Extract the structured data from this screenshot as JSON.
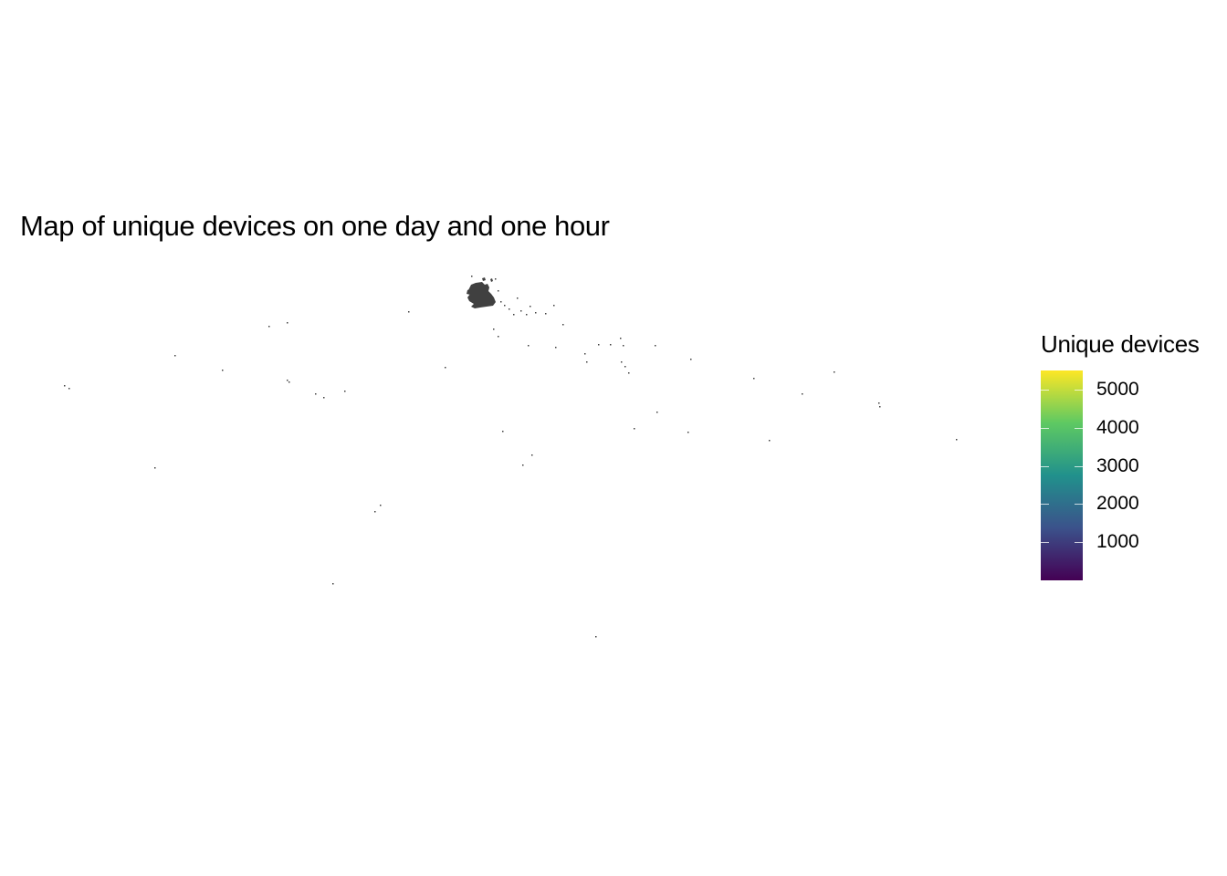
{
  "title": "Map of unique devices on one day and one hour",
  "legend": {
    "title": "Unique devices",
    "min": 0,
    "max": 5500,
    "ticks": [
      {
        "value": 5000,
        "label": "5000"
      },
      {
        "value": 4000,
        "label": "4000"
      },
      {
        "value": 3000,
        "label": "3000"
      },
      {
        "value": 2000,
        "label": "2000"
      },
      {
        "value": 1000,
        "label": "1000"
      }
    ],
    "colors": [
      "#440154",
      "#3b528b",
      "#21918c",
      "#5ec962",
      "#fde725"
    ]
  },
  "map": {
    "land_color": "#404040"
  }
}
